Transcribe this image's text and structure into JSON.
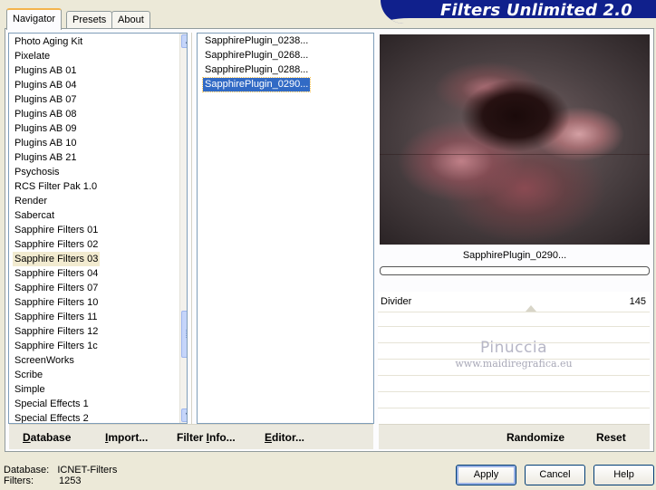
{
  "app": {
    "title": "Filters Unlimited 2.0"
  },
  "tabs": [
    {
      "label": "Navigator",
      "active": true
    },
    {
      "label": "Presets",
      "active": false
    },
    {
      "label": "About",
      "active": false
    }
  ],
  "categories": [
    "Photo Aging Kit",
    "Pixelate",
    "Plugins AB 01",
    "Plugins AB 04",
    "Plugins AB 07",
    "Plugins AB 08",
    "Plugins AB 09",
    "Plugins AB 10",
    "Plugins AB 21",
    "Psychosis",
    "RCS Filter Pak 1.0",
    "Render",
    "Sabercat",
    "Sapphire Filters 01",
    "Sapphire Filters 02",
    "Sapphire Filters 03",
    "Sapphire Filters 04",
    "Sapphire Filters 07",
    "Sapphire Filters 10",
    "Sapphire Filters 11",
    "Sapphire Filters 12",
    "Sapphire Filters 1c",
    "ScreenWorks",
    "Scribe",
    "Simple",
    "Special Effects 1",
    "Special Effects 2"
  ],
  "selected_category": "Sapphire Filters 03",
  "filters": [
    "SapphirePlugin_0238...",
    "SapphirePlugin_0268...",
    "SapphirePlugin_0288...",
    "SapphirePlugin_0290..."
  ],
  "selected_filter": "SapphirePlugin_0290...",
  "preview": {
    "caption": "SapphirePlugin_0290..."
  },
  "params": [
    {
      "label": "Divider",
      "value": "145"
    }
  ],
  "watermark": {
    "name": "Pinuccia",
    "url": "www.maidiregrafica.eu"
  },
  "toolbar_left": [
    {
      "first": "D",
      "rest": "atabase"
    },
    {
      "first": "I",
      "rest": "mport..."
    },
    {
      "first": "Filter ",
      "under": "I",
      "rest": "nfo..."
    },
    {
      "first": "E",
      "rest": "ditor..."
    }
  ],
  "toolbar_right": {
    "randomize": "Randomize",
    "reset": "Reset"
  },
  "status": {
    "database_label": "Database:",
    "database_value": "ICNET-Filters",
    "filters_label": "Filters:",
    "filters_value": "1253"
  },
  "buttons": {
    "apply": "Apply",
    "cancel": "Cancel",
    "help": "Help"
  },
  "colors": {
    "banner": "#10208c",
    "selection": "#316ac5",
    "tab_accent": "#f4b44c"
  }
}
